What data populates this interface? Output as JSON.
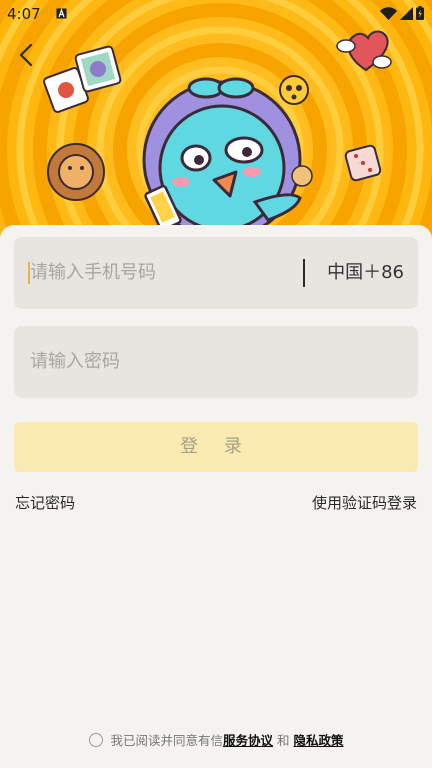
{
  "status_bar": {
    "time": "4:07",
    "notification_icon": "a-letter-icon",
    "wifi_icon": "wifi-icon",
    "signal_icon": "cell-signal-icon",
    "battery_icon": "battery-charging-icon"
  },
  "header": {
    "back_icon": "chevron-left-icon"
  },
  "form": {
    "phone_placeholder": "请输入手机号码",
    "country_code": "中国＋86",
    "password_placeholder": "请输入密码",
    "login_label": "登 录",
    "forgot_password": "忘记密码",
    "sms_login": "使用验证码登录"
  },
  "agreement": {
    "prefix": "我已阅读并同意有信",
    "service_link": " 服务协议",
    "and": " 和 ",
    "privacy_link": "隐私政策"
  },
  "colors": {
    "banner_orange": "#ffb400",
    "button_disabled": "#f8eab0",
    "field_bg": "#e8e5e0"
  }
}
